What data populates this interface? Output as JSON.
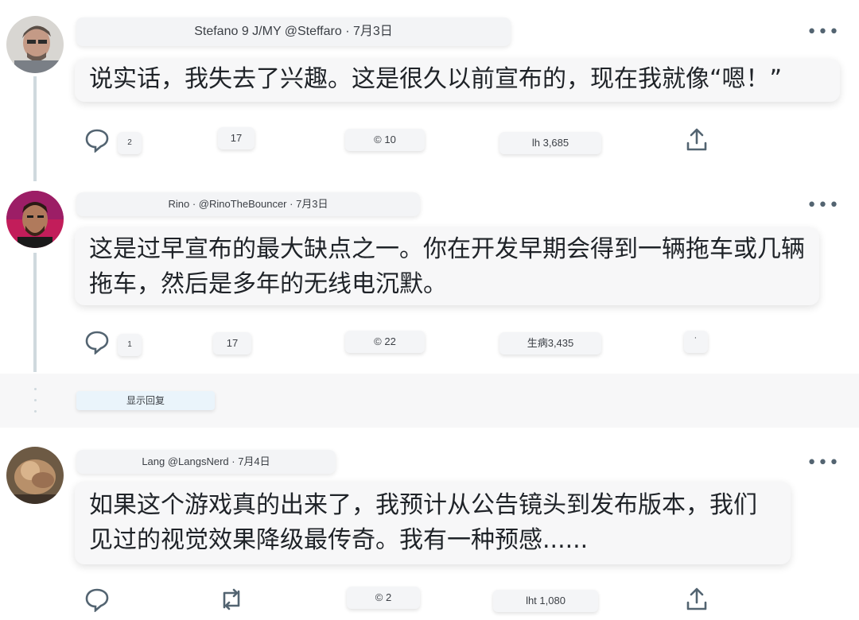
{
  "tweets": [
    {
      "header": "Stefano 9 J/MY @Steffaro · 7月3日",
      "text": "说实话，我失去了兴趣。这是很久以前宣布的，现在我就像“嗯！”",
      "reply_count": "2",
      "retweet_count": "17",
      "like_count": "© 10",
      "view_count": "lh 3,685"
    },
    {
      "header": "Rino · @RinoTheBouncer · 7月3日",
      "text": "这是过早宣布的最大缺点之一。你在开发早期会得到一辆拖车或几辆拖车，然后是多年的无线电沉默。",
      "reply_count": "1",
      "retweet_count": "17",
      "like_count": "© 22",
      "view_count": "生病3,435"
    },
    {
      "header": "Lang @LangsNerd · 7月4日",
      "text": "如果这个游戏真的出来了，我预计从公告镜头到发布版本，我们见过的视觉效果降级最传奇。我有一种预感......",
      "like_count": "© 2",
      "view_count": "lht 1,080"
    }
  ],
  "show_replies_label": "显示回复",
  "colors": {
    "icon": "#536471",
    "thread_line": "#cfd9de"
  }
}
